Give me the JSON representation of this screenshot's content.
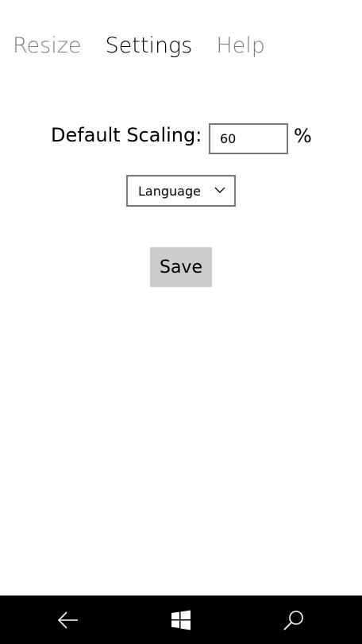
{
  "pivot": {
    "tabs": [
      {
        "label": "Resize"
      },
      {
        "label": "Settings"
      },
      {
        "label": "Help"
      }
    ],
    "active_index": 1
  },
  "settings": {
    "scaling_label": "Default Scaling:",
    "scaling_value": "60",
    "percent_sign": "%",
    "language_combo_label": "Language",
    "save_label": "Save"
  },
  "navbar": {
    "buttons": [
      "back-arrow-icon",
      "windows-start-icon",
      "search-icon"
    ],
    "background": "#000000"
  },
  "colors": {
    "active_tab": "#000000",
    "inactive_tab": "#808080",
    "button_bg": "#cccccc",
    "border": "#7a7a7a"
  }
}
